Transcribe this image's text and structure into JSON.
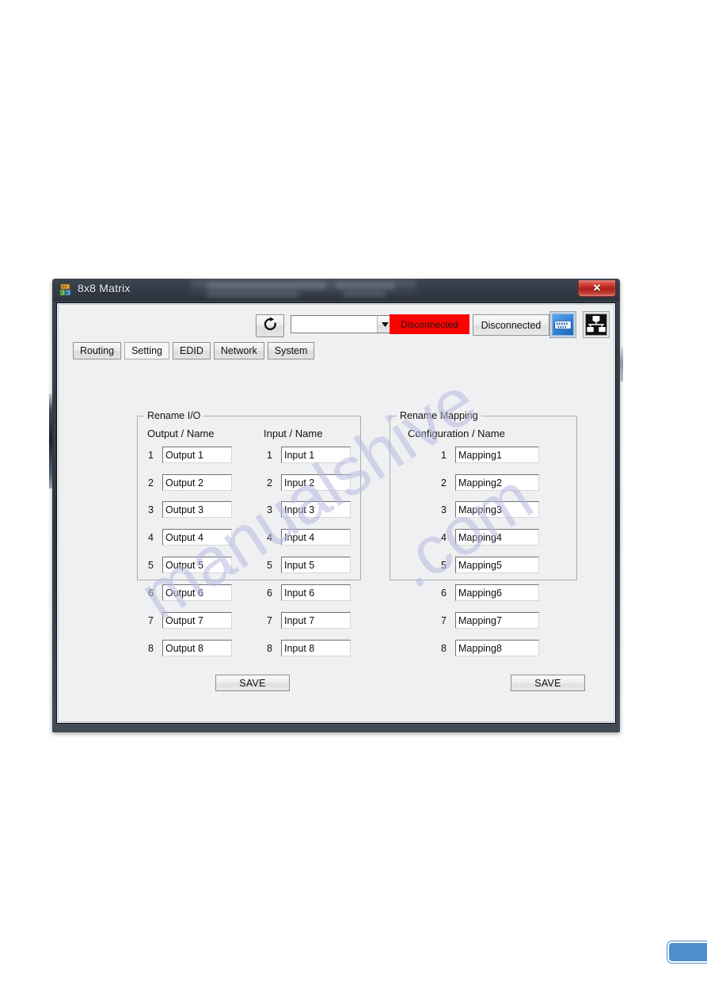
{
  "window": {
    "title": "8x8 Matrix",
    "close_label": "✕",
    "app_icon": "matrix-app-icon"
  },
  "toolbar": {
    "refresh_icon": "refresh-icon",
    "port_combo": {
      "value": "",
      "placeholder": "",
      "arrow_icon": "chevron-down-icon"
    },
    "connection_status_badge": "Disconnected",
    "connection_status_box": "Disconnected",
    "status_badge_color": "#ff0000",
    "serial_button_icon": "serial-port-icon",
    "lan_button_icon": "network-topology-icon"
  },
  "tabs": [
    {
      "label": "Routing",
      "active": false
    },
    {
      "label": "Setting",
      "active": true
    },
    {
      "label": "EDID",
      "active": false
    },
    {
      "label": "Network",
      "active": false
    },
    {
      "label": "System",
      "active": false
    }
  ],
  "rename_io": {
    "group_title": "Rename  I/O",
    "output_header": "Output  /  Name",
    "input_header": "Input  /  Name",
    "save_label": "SAVE",
    "outputs": [
      {
        "index": "1",
        "name": "Output 1"
      },
      {
        "index": "2",
        "name": "Output 2"
      },
      {
        "index": "3",
        "name": "Output 3"
      },
      {
        "index": "4",
        "name": "Output 4"
      },
      {
        "index": "5",
        "name": "Output 5"
      },
      {
        "index": "6",
        "name": "Output 6"
      },
      {
        "index": "7",
        "name": "Output 7"
      },
      {
        "index": "8",
        "name": "Output 8"
      }
    ],
    "inputs": [
      {
        "index": "1",
        "name": "Input 1"
      },
      {
        "index": "2",
        "name": "Input 2"
      },
      {
        "index": "3",
        "name": "Input 3"
      },
      {
        "index": "4",
        "name": "Input 4"
      },
      {
        "index": "5",
        "name": "Input 5"
      },
      {
        "index": "6",
        "name": "Input 6"
      },
      {
        "index": "7",
        "name": "Input 7"
      },
      {
        "index": "8",
        "name": "Input 8"
      }
    ]
  },
  "rename_mapping": {
    "group_title": "Rename Mapping",
    "header": "Configuration / Name",
    "save_label": "SAVE",
    "rows": [
      {
        "index": "1",
        "name": "Mapping1"
      },
      {
        "index": "2",
        "name": "Mapping2"
      },
      {
        "index": "3",
        "name": "Mapping3"
      },
      {
        "index": "4",
        "name": "Mapping4"
      },
      {
        "index": "5",
        "name": "Mapping5"
      },
      {
        "index": "6",
        "name": "Mapping6"
      },
      {
        "index": "7",
        "name": "Mapping7"
      },
      {
        "index": "8",
        "name": "Mapping8"
      }
    ]
  },
  "watermark": {
    "line_a": "manualshive",
    "line_b": ".com"
  }
}
